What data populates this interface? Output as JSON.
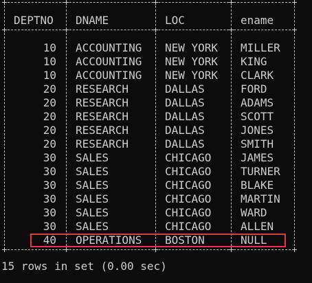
{
  "table": {
    "columns": [
      "DEPTNO",
      "DNAME",
      "LOC",
      "ename"
    ],
    "rows": [
      [
        "10",
        "ACCOUNTING",
        "NEW YORK",
        "MILLER"
      ],
      [
        "10",
        "ACCOUNTING",
        "NEW YORK",
        "KING"
      ],
      [
        "10",
        "ACCOUNTING",
        "NEW YORK",
        "CLARK"
      ],
      [
        "20",
        "RESEARCH",
        "DALLAS",
        "FORD"
      ],
      [
        "20",
        "RESEARCH",
        "DALLAS",
        "ADAMS"
      ],
      [
        "20",
        "RESEARCH",
        "DALLAS",
        "SCOTT"
      ],
      [
        "20",
        "RESEARCH",
        "DALLAS",
        "JONES"
      ],
      [
        "20",
        "RESEARCH",
        "DALLAS",
        "SMITH"
      ],
      [
        "30",
        "SALES",
        "CHICAGO",
        "JAMES"
      ],
      [
        "30",
        "SALES",
        "CHICAGO",
        "TURNER"
      ],
      [
        "30",
        "SALES",
        "CHICAGO",
        "BLAKE"
      ],
      [
        "30",
        "SALES",
        "CHICAGO",
        "MARTIN"
      ],
      [
        "30",
        "SALES",
        "CHICAGO",
        "WARD"
      ],
      [
        "30",
        "SALES",
        "CHICAGO",
        "ALLEN"
      ],
      [
        "40",
        "OPERATIONS",
        "BOSTON",
        "NULL"
      ]
    ],
    "highlighted_row": 14
  },
  "footer": {
    "text": "15 rows in set (0.00 sec)"
  },
  "colors": {
    "background": "#0c0c0c",
    "text": "#cccccc",
    "highlight_border": "#e23a3a"
  }
}
